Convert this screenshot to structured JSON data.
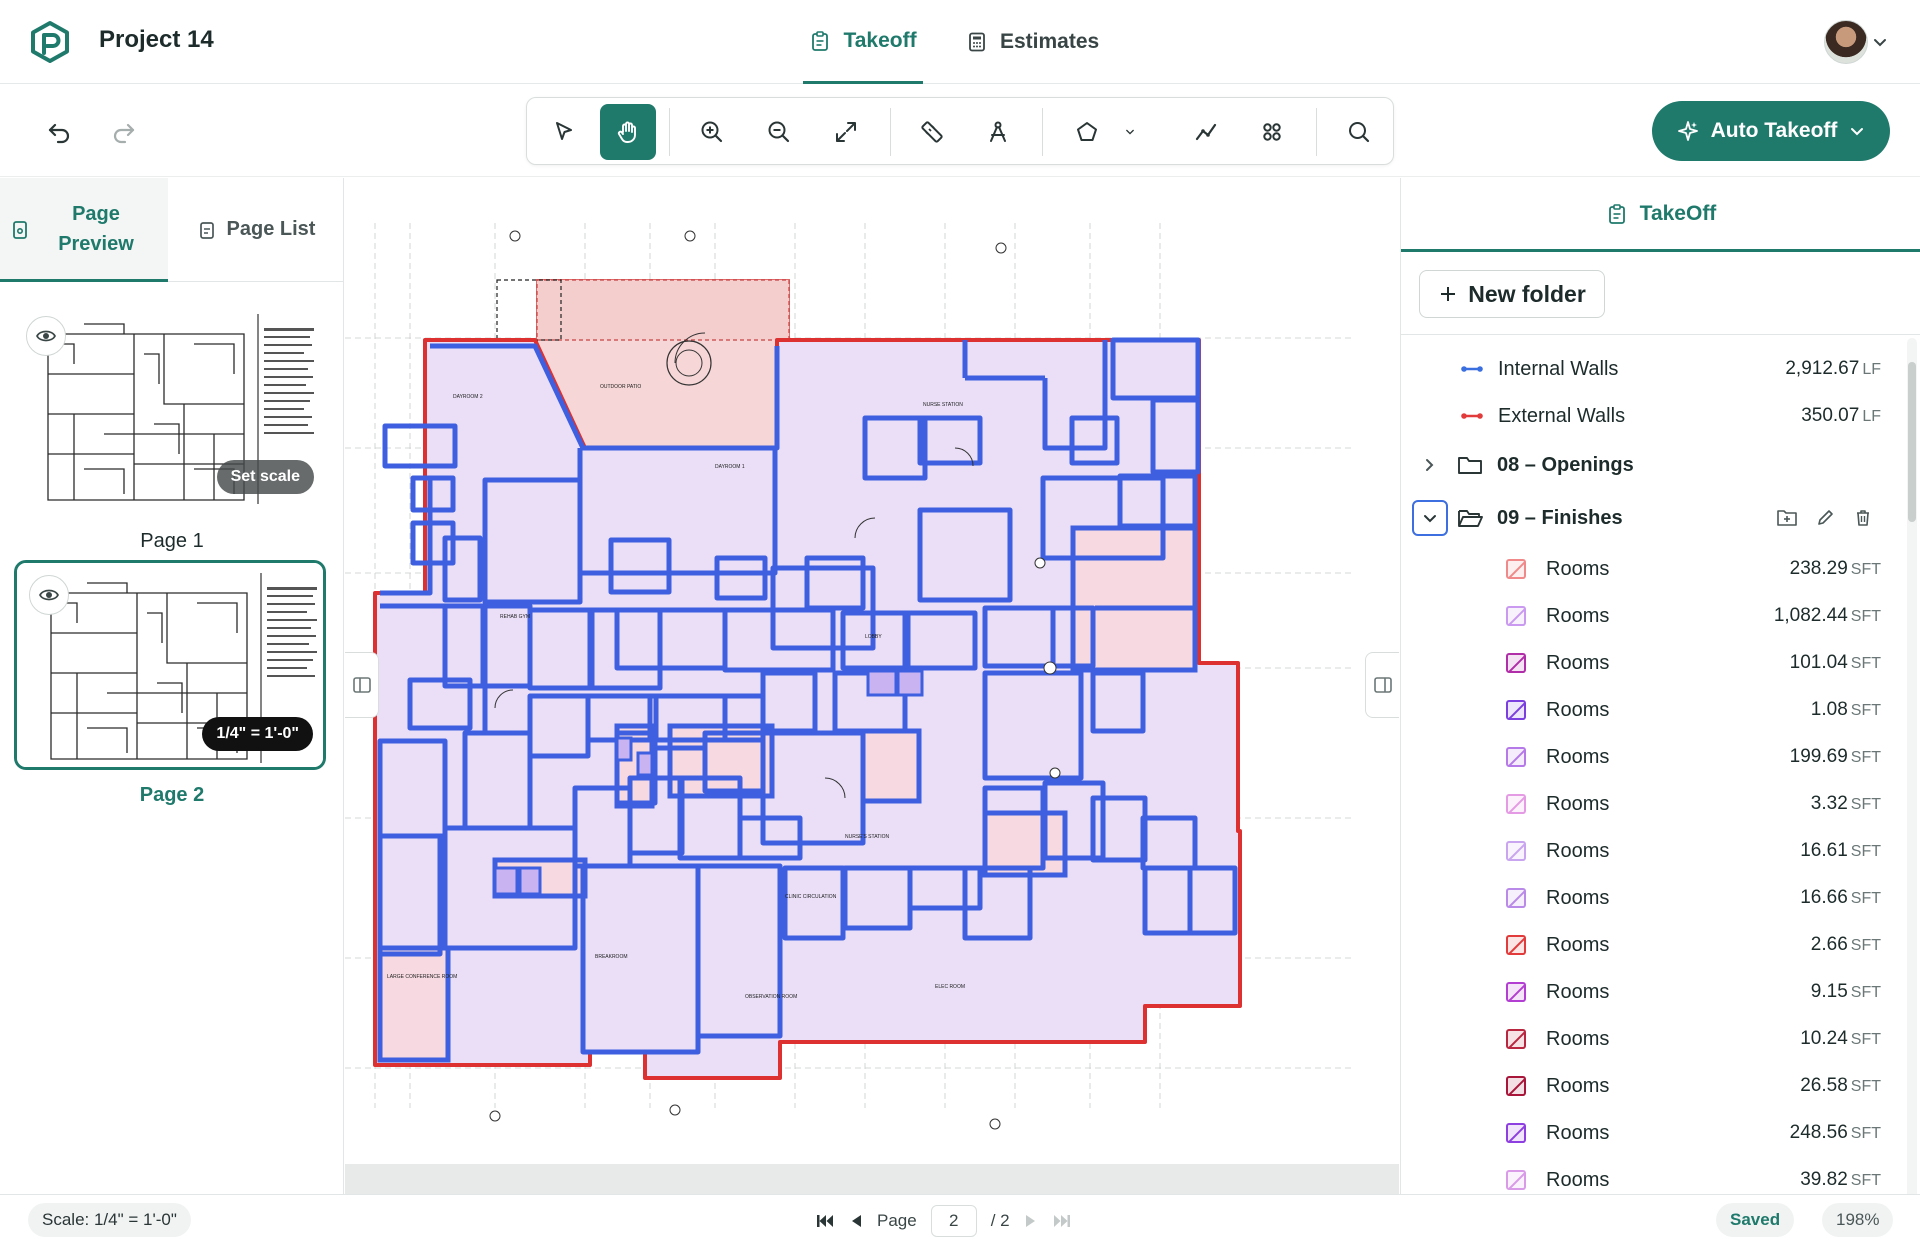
{
  "header": {
    "project_title": "Project 14",
    "tabs": [
      {
        "label": "Takeoff",
        "active": true
      },
      {
        "label": "Estimates",
        "active": false
      }
    ]
  },
  "toolbar": {
    "tools": [
      "select",
      "pan",
      "zoom-in",
      "zoom-out",
      "fit",
      "measure",
      "scale",
      "polygon",
      "polygon-options",
      "polyline",
      "count",
      "search"
    ],
    "active_tool": "pan",
    "auto_takeoff_label": "Auto Takeoff"
  },
  "left_panel": {
    "tabs": [
      {
        "label": "Page Preview",
        "active": true
      },
      {
        "label": "Page List",
        "active": false
      }
    ],
    "pages": [
      {
        "label": "Page 1",
        "badge": "Set scale",
        "selected": false
      },
      {
        "label": "Page 2",
        "badge": "1/4\" = 1'-0\"",
        "selected": true
      }
    ]
  },
  "right_panel": {
    "tab_label": "TakeOff",
    "new_folder_label": "New folder",
    "items": [
      {
        "name": "Internal Walls",
        "value": "2,912.67",
        "unit": "LF",
        "color": "#3a6fe0"
      },
      {
        "name": "External Walls",
        "value": "350.07",
        "unit": "LF",
        "color": "#e23b3b"
      }
    ],
    "folders": [
      {
        "name": "08 – Openings",
        "expanded": false
      },
      {
        "name": "09 – Finishes",
        "expanded": true
      }
    ],
    "finishes": [
      {
        "name": "Rooms",
        "value": "238.29",
        "unit": "SFT",
        "color": "#f08a8a"
      },
      {
        "name": "Rooms",
        "value": "1,082.44",
        "unit": "SFT",
        "color": "#c99aef"
      },
      {
        "name": "Rooms",
        "value": "101.04",
        "unit": "SFT",
        "color": "#b02fa8"
      },
      {
        "name": "Rooms",
        "value": "1.08",
        "unit": "SFT",
        "color": "#7b3fe0"
      },
      {
        "name": "Rooms",
        "value": "199.69",
        "unit": "SFT",
        "color": "#b57ae8"
      },
      {
        "name": "Rooms",
        "value": "3.32",
        "unit": "SFT",
        "color": "#e59ae4"
      },
      {
        "name": "Rooms",
        "value": "16.61",
        "unit": "SFT",
        "color": "#c9a4ef"
      },
      {
        "name": "Rooms",
        "value": "16.66",
        "unit": "SFT",
        "color": "#b98ae8"
      },
      {
        "name": "Rooms",
        "value": "2.66",
        "unit": "SFT",
        "color": "#e23b3b"
      },
      {
        "name": "Rooms",
        "value": "9.15",
        "unit": "SFT",
        "color": "#b33fd2"
      },
      {
        "name": "Rooms",
        "value": "10.24",
        "unit": "SFT",
        "color": "#b8263f"
      },
      {
        "name": "Rooms",
        "value": "26.58",
        "unit": "SFT",
        "color": "#a8173a"
      },
      {
        "name": "Rooms",
        "value": "248.56",
        "unit": "SFT",
        "color": "#8e3fe0"
      },
      {
        "name": "Rooms",
        "value": "39.82",
        "unit": "SFT",
        "color": "#d99ae8"
      }
    ]
  },
  "statusbar": {
    "scale": "Scale: 1/4\" = 1'-0\"",
    "page_label": "Page",
    "page_current": "2",
    "page_total": "/ 2",
    "saved": "Saved",
    "zoom": "198%"
  },
  "colors": {
    "accent": "#1f7a6c",
    "internal_wall": "#3a6fe0",
    "external_wall": "#e23b3b"
  }
}
